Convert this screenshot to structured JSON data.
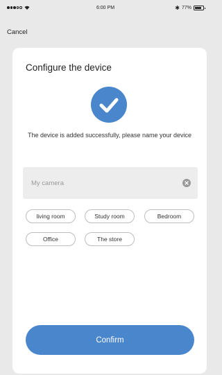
{
  "status_bar": {
    "time": "6:00 PM",
    "battery": "77%",
    "battery_level": 0.77,
    "icons": [
      "signal-dots-icon",
      "wifi-icon",
      "bluetooth-icon",
      "battery-icon"
    ]
  },
  "nav": {
    "cancel_label": "Cancel"
  },
  "card": {
    "title": "Configure the device",
    "success_icon": "checkmark-circle-icon",
    "message": "The device is added successfully, please name your device"
  },
  "name_input": {
    "placeholder": "My camera",
    "value": "",
    "clear_icon": "clear-circle-icon"
  },
  "room_chips": [
    "living room",
    "Study room",
    "Bedroom",
    "Office",
    "The store"
  ],
  "confirm_label": "Confirm",
  "colors": {
    "accent": "#4a86cc",
    "background": "#e9e9e9",
    "card": "#ffffff",
    "input_bg": "#ededed"
  }
}
